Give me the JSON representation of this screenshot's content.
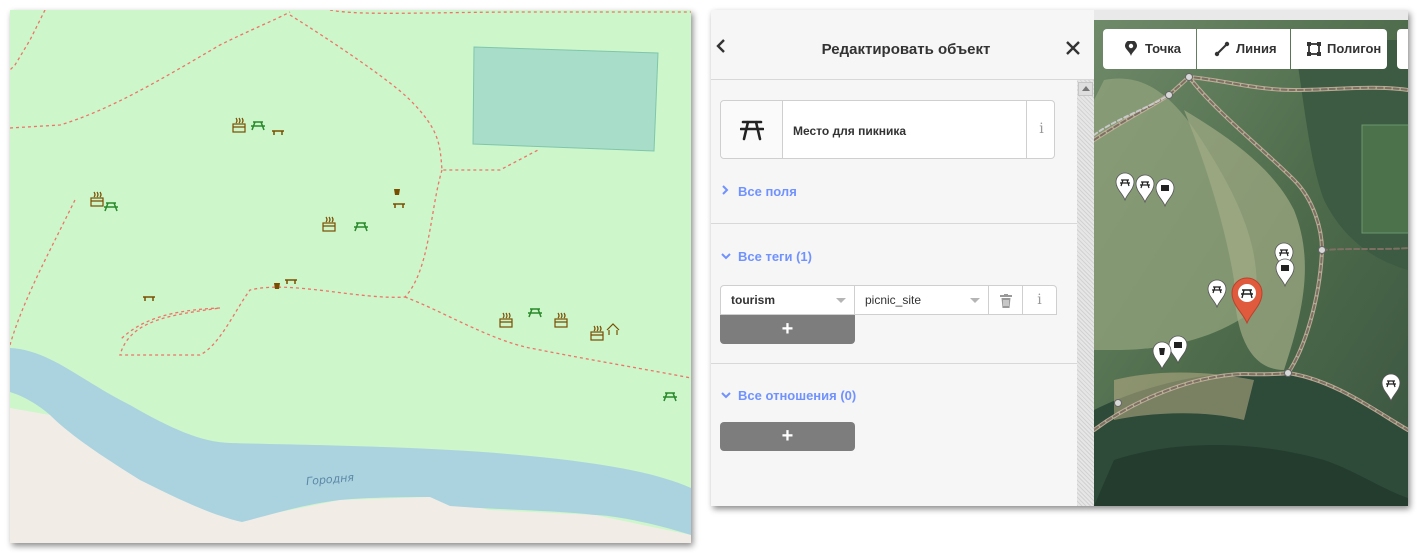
{
  "left_map": {
    "river_label": "Городня",
    "colors": {
      "grass": "#cdf6cb",
      "water": "#aad3df",
      "sand": "#f1ede6",
      "path": "#ff6d5a",
      "pond": "#a8ddc9",
      "amenity": "#2a8a2a",
      "bbq": "#7a4e00"
    }
  },
  "editor": {
    "sidebar": {
      "title": "Редактировать объект",
      "preset": {
        "icon": "picnic-table-icon",
        "name": "Место для пикника",
        "info": "i"
      },
      "all_fields": {
        "label": "Все поля",
        "expanded": false
      },
      "all_tags": {
        "label": "Все теги (1)",
        "expanded": true,
        "rows": [
          {
            "key": "tourism",
            "value": "picnic_site"
          }
        ],
        "info": "i",
        "add": "+"
      },
      "all_relations": {
        "label": "Все отношения (0)",
        "expanded": true,
        "add": "+"
      }
    },
    "toolbar": {
      "point": "Точка",
      "line": "Линия",
      "area": "Полигон"
    },
    "accent": "#7092ff",
    "selected_marker_color": "#e05a3e"
  }
}
